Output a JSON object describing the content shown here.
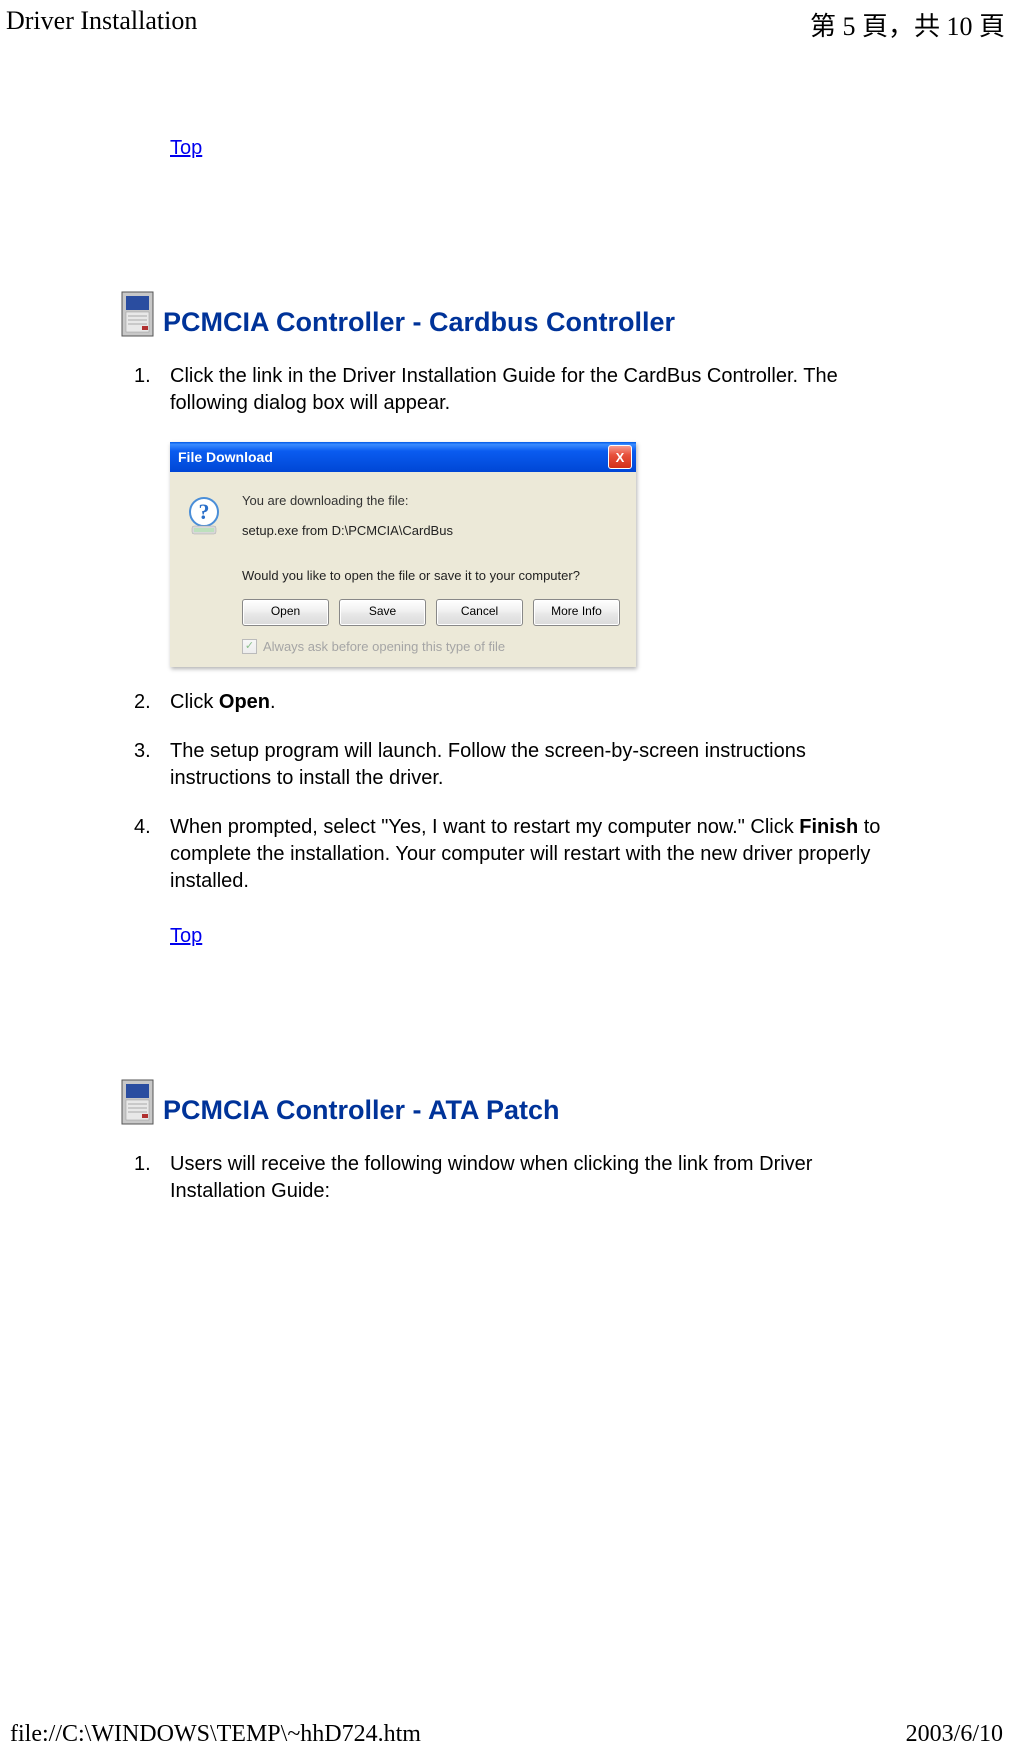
{
  "header": {
    "left": "Driver Installation",
    "right": "第 5 頁，共 10 頁"
  },
  "footer": {
    "left": "file://C:\\WINDOWS\\TEMP\\~hhD724.htm",
    "right": "2003/6/10"
  },
  "links": {
    "top": "Top"
  },
  "section1": {
    "title": "PCMCIA Controller - Cardbus Controller",
    "steps": {
      "s1": "Click the link in the Driver Installation Guide for the CardBus Controller. The following dialog box will appear.",
      "s2_prefix": "Click ",
      "s2_bold": "Open",
      "s2_suffix": ".",
      "s3": "The setup program will launch. Follow the screen-by-screen instructions instructions to install the driver.",
      "s4_prefix": "When prompted, select \"Yes, I want to restart my computer now.\" Click ",
      "s4_bold": "Finish",
      "s4_suffix": " to complete the installation. Your computer will restart with the new driver properly installed."
    }
  },
  "section2": {
    "title": "PCMCIA Controller - ATA Patch",
    "steps": {
      "s1": "Users will receive the following window when clicking the link from Driver Installation Guide:"
    }
  },
  "dialog": {
    "title": "File Download",
    "line1": "You are downloading the file:",
    "line2": "setup.exe from D:\\PCMCIA\\CardBus",
    "question": "Would you like to open the file or save it to your computer?",
    "buttons": {
      "open": "Open",
      "save": "Save",
      "cancel": "Cancel",
      "moreinfo": "More Info"
    },
    "checkbox_label": "Always ask before opening this type of file",
    "checkbox_mark": "✓",
    "close_x": "X"
  }
}
